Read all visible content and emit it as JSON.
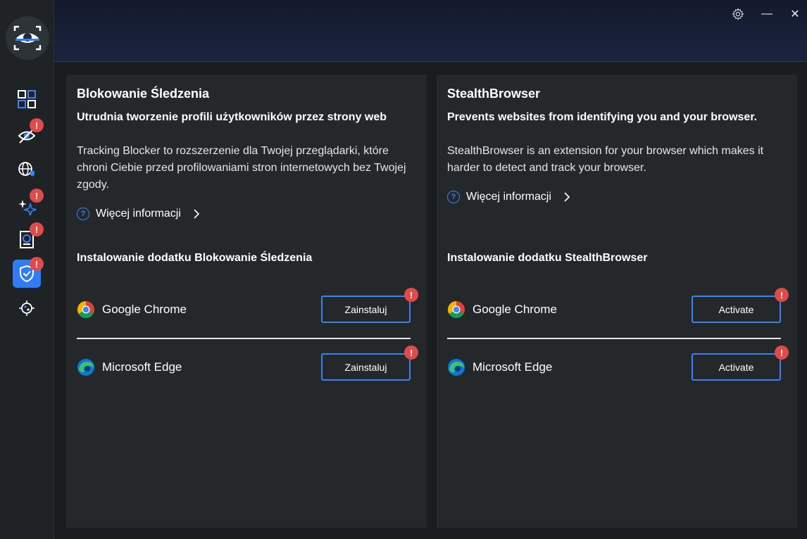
{
  "window": {
    "settings_icon": "gear-icon",
    "minimize_label": "—",
    "close_label": "✕"
  },
  "sidebar": {
    "logo_icon": "eye-scan-logo",
    "items": [
      {
        "icon": "dashboard-grid-icon",
        "badge": ""
      },
      {
        "icon": "eye-hidden-icon",
        "badge": "!"
      },
      {
        "icon": "globe-shield-icon",
        "badge": ""
      },
      {
        "icon": "sparkles-icon",
        "badge": "!"
      },
      {
        "icon": "device-scan-icon",
        "badge": "!"
      },
      {
        "icon": "shield-check-icon",
        "badge": "!"
      },
      {
        "icon": "virus-icon",
        "badge": ""
      }
    ]
  },
  "cards": [
    {
      "title": "Blokowanie Śledzenia",
      "subtitle": "Utrudnia tworzenie profili użytkowników przez strony web",
      "description": "Tracking Blocker to rozszerzenie dla Twojej przeglądarki, które chroni Ciebie przed profilowaniami stron internetowych bez Twojej zgody.",
      "more_info": "Więcej informacji",
      "install_title": "Instalowanie dodatku Blokowanie Śledzenia",
      "browsers": [
        {
          "name": "Google Chrome",
          "action": "Zainstaluj",
          "badge": "!"
        },
        {
          "name": "Microsoft Edge",
          "action": "Zainstaluj",
          "badge": "!"
        }
      ]
    },
    {
      "title": "StealthBrowser",
      "subtitle": "Prevents websites from identifying you and your browser.",
      "description": "StealthBrowser is an extension for your browser which makes it harder to detect and track your browser.",
      "more_info": "Więcej informacji",
      "install_title": "Instalowanie dodatku StealthBrowser",
      "browsers": [
        {
          "name": "Google Chrome",
          "action": "Activate",
          "badge": "!"
        },
        {
          "name": "Microsoft Edge",
          "action": "Activate",
          "badge": "!"
        }
      ]
    }
  ],
  "colors": {
    "accent": "#3b82f6",
    "badge": "#e04a4a",
    "card_bg": "#25282b",
    "sidebar_bg": "#202326"
  }
}
